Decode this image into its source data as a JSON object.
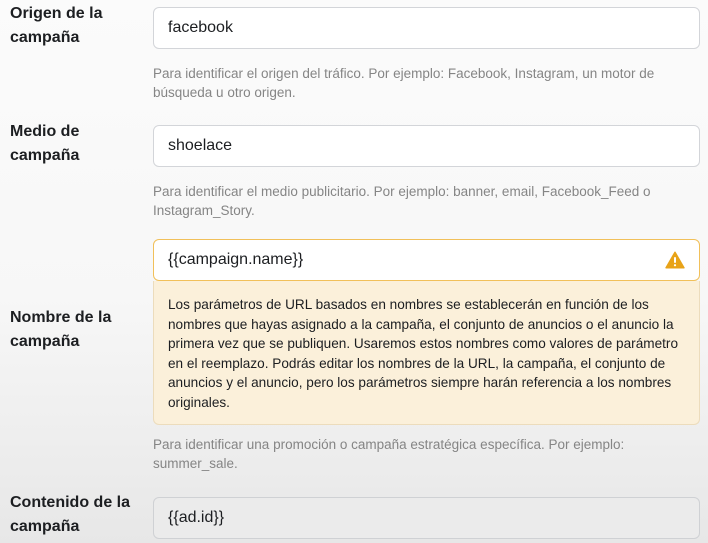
{
  "fields": {
    "source": {
      "label": "Origen de la campaña",
      "value": "facebook",
      "helper": "Para identificar el origen del tráfico. Por ejemplo: Facebook, Instagram, un motor de búsqueda u otro origen."
    },
    "medium": {
      "label": "Medio de campaña",
      "value": "shoelace",
      "helper": "Para identificar el medio publicitario. Por ejemplo: banner, email, Facebook_Feed o Instagram_Story."
    },
    "name": {
      "label": "Nombre de la campaña",
      "value": "{{campaign.name}}",
      "warning": "Los parámetros de URL basados en nombres se establecerán en función de los nombres que hayas asignado a la campaña, el conjunto de anuncios o el anuncio la primera vez que se publiquen. Usaremos estos nombres como valores de parámetro en el reemplazo. Podrás editar los nombres de la URL, la campaña, el conjunto de anuncios y el anuncio, pero los parámetros siempre harán referencia a los nombres originales.",
      "helper": "Para identificar una promoción o campaña estratégica específica. Por ejemplo: summer_sale.",
      "warning_icon": "warning-triangle-icon"
    },
    "content": {
      "label": "Contenido de la campaña",
      "value": "{{ad.id}}"
    }
  },
  "colors": {
    "warning_border": "#f1c05a",
    "warning_bg": "#fbf0da",
    "warning_icon": "#e8a318",
    "helper_text": "#858585"
  }
}
